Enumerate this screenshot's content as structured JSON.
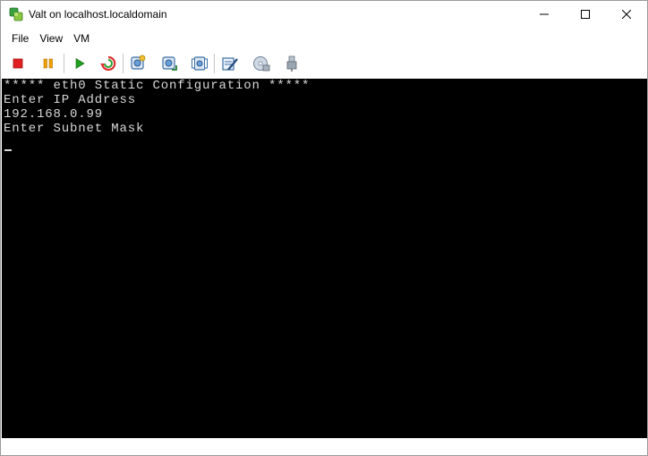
{
  "window": {
    "title": "Valt on localhost.localdomain",
    "controls": {
      "minimize": "minimize-icon",
      "maximize": "maximize-icon",
      "close": "close-icon"
    }
  },
  "menu": {
    "file": {
      "label": "File"
    },
    "view": {
      "label": "View"
    },
    "vm": {
      "label": "VM"
    }
  },
  "toolbar": {
    "buttons": [
      {
        "name": "power-off",
        "icon": "stop-icon",
        "color": "#e02020"
      },
      {
        "name": "suspend",
        "icon": "pause-icon",
        "color": "#f0a000"
      },
      {
        "name": "power-on",
        "icon": "play-icon",
        "color": "#20a020"
      },
      {
        "name": "reset",
        "icon": "reset-icon",
        "color": "#e03030"
      },
      {
        "name": "snapshot",
        "icon": "snapshot-icon"
      },
      {
        "name": "revert-snapshot",
        "icon": "revert-snapshot-icon"
      },
      {
        "name": "snapshot-manager",
        "icon": "snapshot-manager-icon"
      },
      {
        "name": "edit-settings",
        "icon": "edit-settings-icon"
      },
      {
        "name": "cd-dvd",
        "icon": "cd-icon"
      },
      {
        "name": "usb",
        "icon": "usb-icon"
      }
    ]
  },
  "console": {
    "lines": [
      "***** eth0 Static Configuration *****",
      "Enter IP Address",
      "192.168.0.99",
      "Enter Subnet Mask"
    ],
    "background": "#000000",
    "foreground": "#d8d8d8"
  }
}
